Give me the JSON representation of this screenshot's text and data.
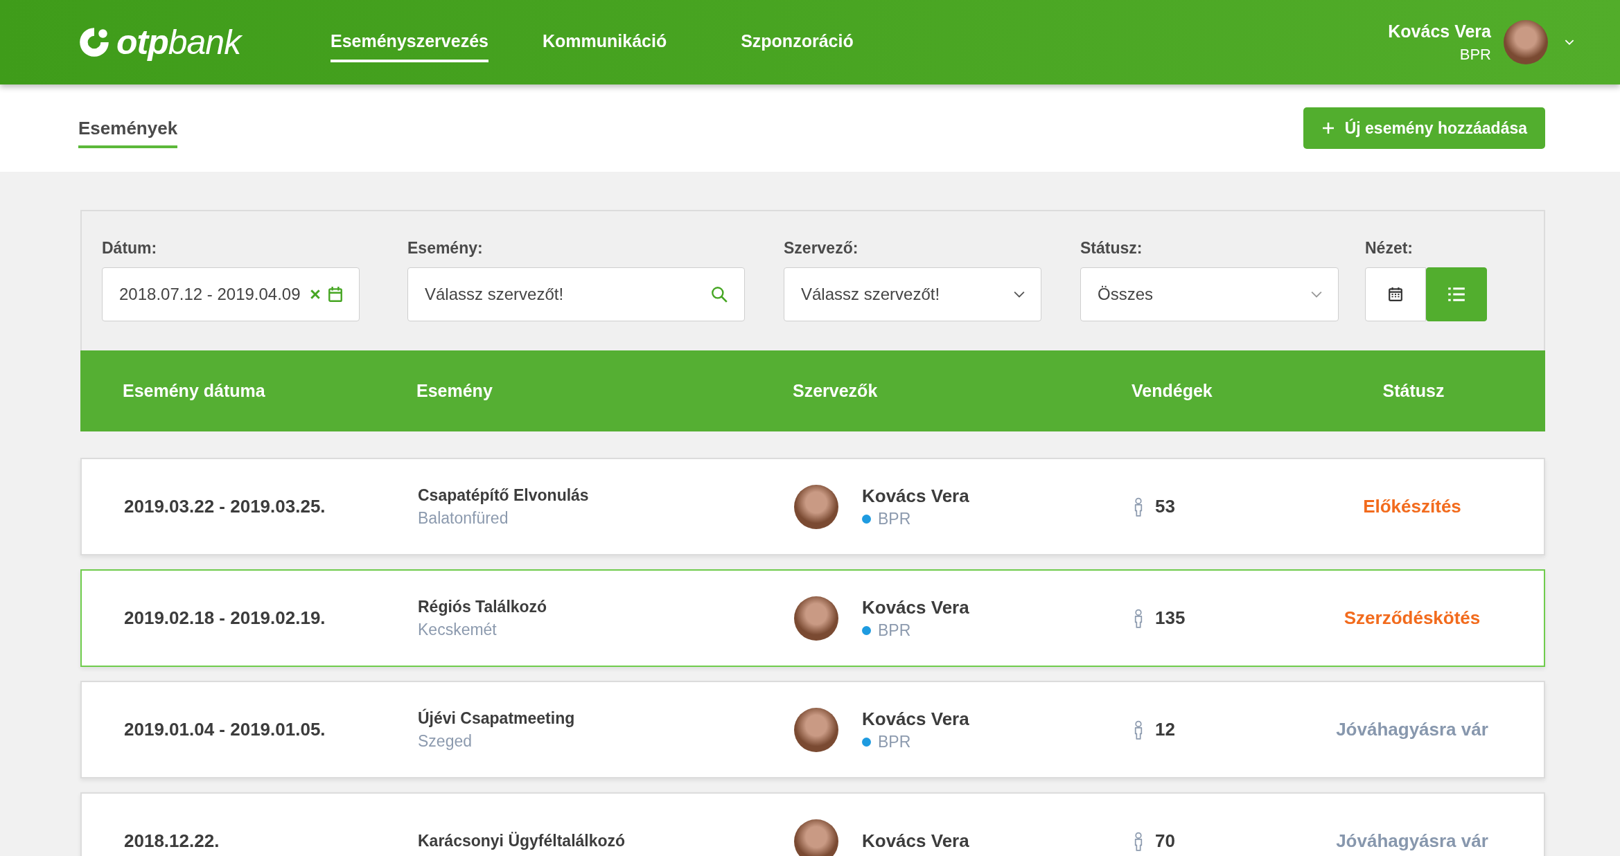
{
  "header": {
    "logo": "**otp**bank",
    "nav": [
      {
        "label": "Eseményszervezés",
        "selected": true
      },
      {
        "label": "Kommunikáció",
        "selected": false
      },
      {
        "label": "Szponzoráció",
        "selected": false
      }
    ],
    "user": {
      "name": "Kovács Vera",
      "role": "BPR"
    }
  },
  "subheader": {
    "tabs": [
      {
        "label": "Események",
        "selected": true
      }
    ],
    "add_button": "Új esemény hozzáadása"
  },
  "filters": {
    "date": {
      "label": "Dátum:",
      "value": "2018.07.12 - 2019.04.09"
    },
    "event": {
      "label": "Esemény:",
      "placeholder": "Válassz szervezőt!"
    },
    "organizer": {
      "label": "Szervező:",
      "placeholder": "Válassz szervezőt!"
    },
    "status": {
      "label": "Státusz:",
      "value": "Összes"
    },
    "view": {
      "label": "Nézet:",
      "options": [
        {
          "kind": "calendar",
          "selected": false
        },
        {
          "kind": "list",
          "selected": true
        }
      ]
    }
  },
  "table": {
    "columns": [
      "Esemény dátuma",
      "Esemény",
      "Szervezők",
      "Vendégek",
      "Státusz"
    ],
    "rows": [
      {
        "date": "2019.03.22 - 2019.03.25.",
        "event": "Csapatépítő Elvonulás",
        "location": "Balatonfüred",
        "organizer": "Kovács Vera",
        "team": {
          "name": "BPR",
          "color": "#1e9be0"
        },
        "guests": "53",
        "status": {
          "label": "Előkészítés",
          "color": "#f26b1d"
        },
        "selected": false
      },
      {
        "date": "2019.02.18 - 2019.02.19.",
        "event": "Régiós Találkozó",
        "location": "Kecskemét",
        "organizer": "Kovács Vera",
        "team": {
          "name": "BPR",
          "color": "#1e9be0"
        },
        "guests": "135",
        "status": {
          "label": "Szerződéskötés",
          "color": "#f26b1d"
        },
        "selected": true
      },
      {
        "date": "2019.01.04 - 2019.01.05.",
        "event": "Újévi Csapatmeeting",
        "location": "Szeged",
        "organizer": "Kovács Vera",
        "team": {
          "name": "BPR",
          "color": "#1e9be0"
        },
        "guests": "12",
        "status": {
          "label": "Jóváhagyásra vár",
          "color": "#8797ad"
        },
        "selected": false
      },
      {
        "date": "2018.12.22.",
        "event": "Karácsonyi Ügyféltalálkozó",
        "organizer": "Kovács Vera",
        "guests": "70",
        "status": {
          "label": "Jóváhagyásra vár",
          "color": "#8797ad"
        },
        "selected": false
      }
    ]
  }
}
